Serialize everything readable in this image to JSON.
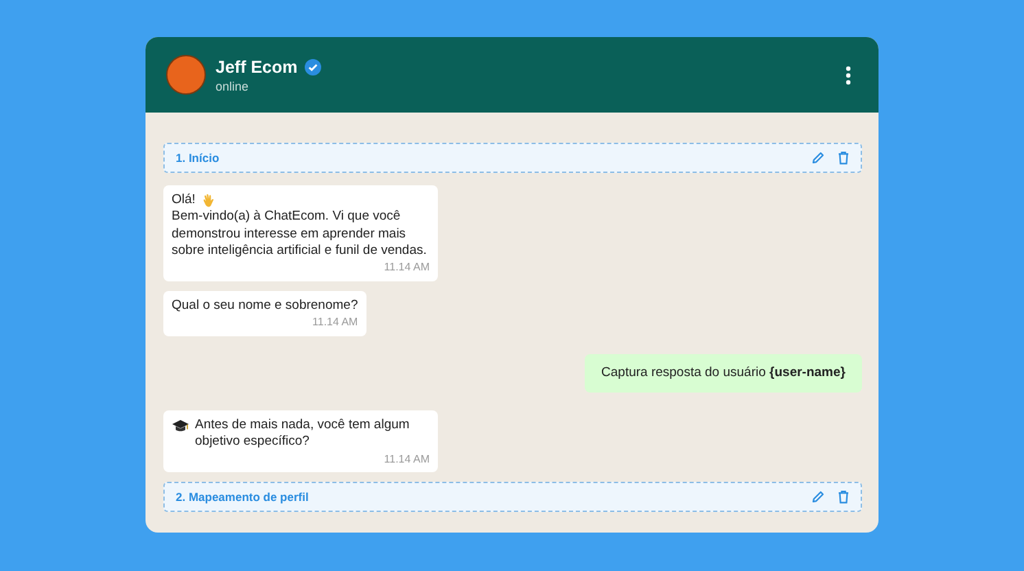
{
  "contact": {
    "name": "Jeff Ecom",
    "verified": true,
    "status": "online"
  },
  "messages": [
    {
      "kind": "section",
      "label": "1. Início"
    },
    {
      "kind": "greeting",
      "lead": "Olá!",
      "text": "Bem-vindo(a) à ChatEcom. Vi que você demonstrou interesse em aprender mais sobre inteligência artificial e funil de vendas.",
      "time": "11.14 AM"
    },
    {
      "kind": "incoming",
      "text": "Qual o seu nome e sobrenome?",
      "time": "11.14 AM"
    },
    {
      "kind": "outgoing",
      "text": "Captura resposta do usuário **{user-name}**"
    },
    {
      "kind": "topic",
      "text": "Antes de mais nada, você tem algum objetivo específico?",
      "time": "11.14 AM"
    },
    {
      "kind": "section",
      "label": "2. Mapeamento de perfil"
    }
  ]
}
